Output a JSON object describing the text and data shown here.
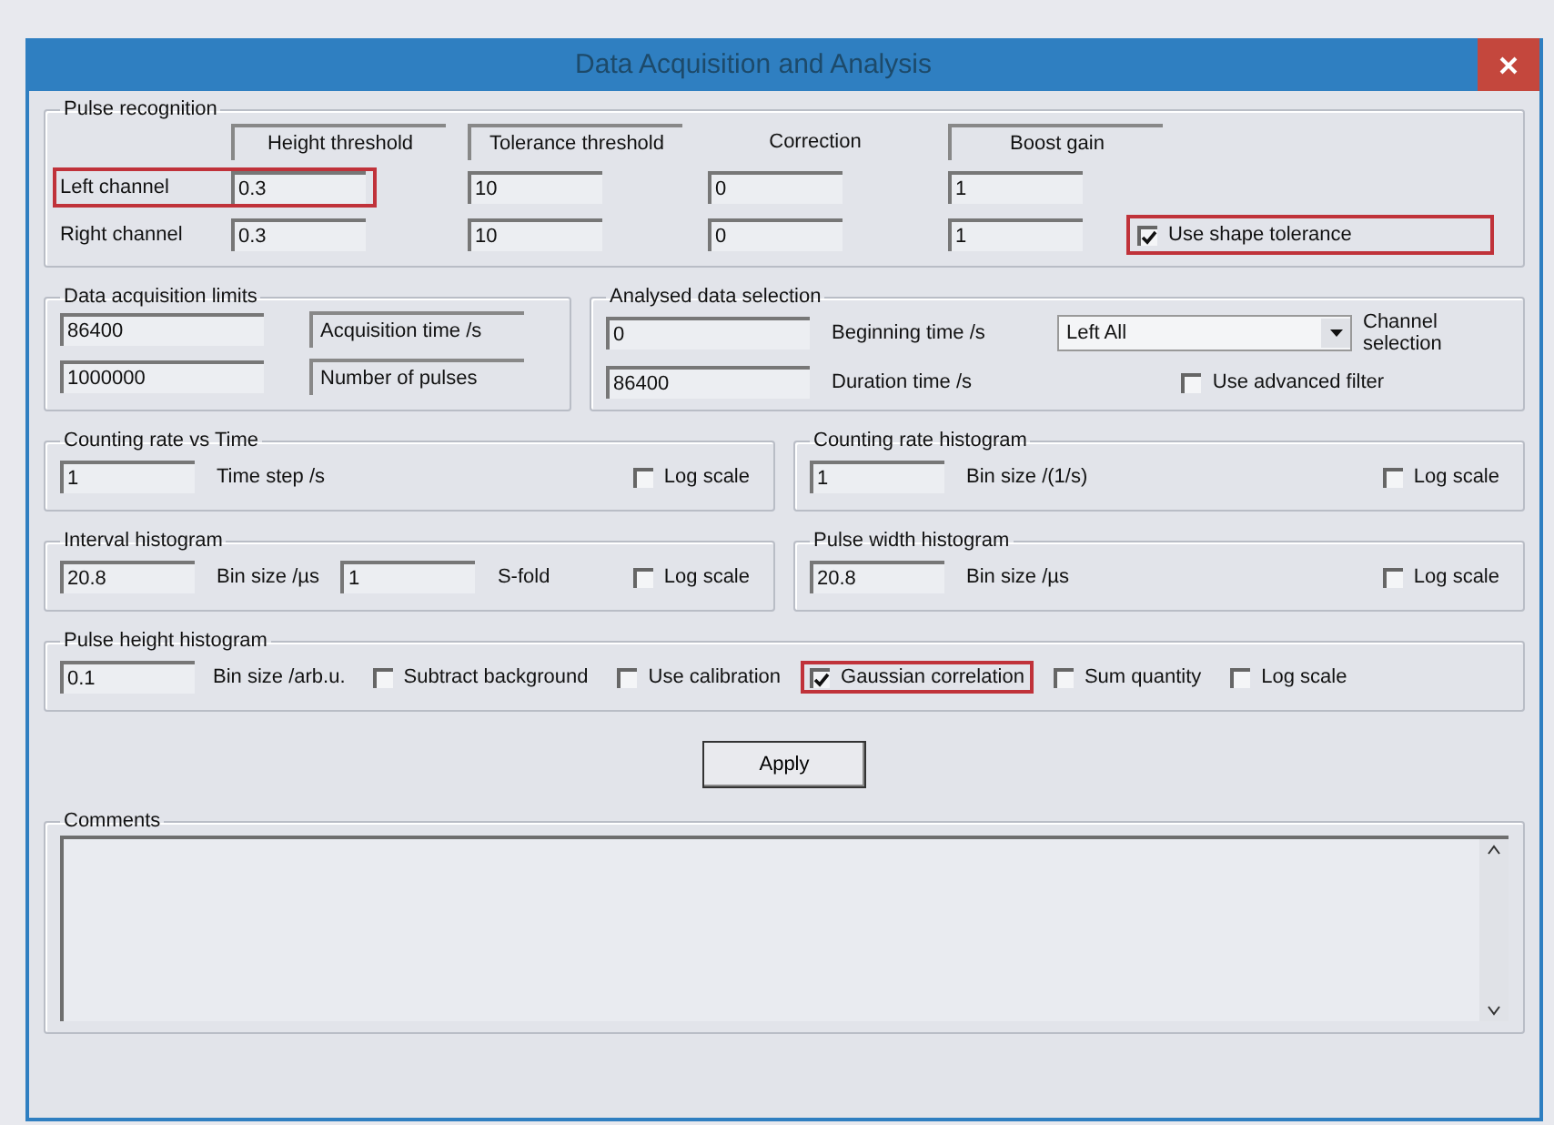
{
  "window": {
    "title": "Data Acquisition and Analysis"
  },
  "pulse_recognition": {
    "title": "Pulse recognition",
    "columns": [
      {
        "label": "Height threshold",
        "framed": true
      },
      {
        "label": "Tolerance threshold",
        "framed": true
      },
      {
        "label": "Correction",
        "framed": false
      },
      {
        "label": "Boost gain",
        "framed": true
      }
    ],
    "rows": [
      {
        "label": "Left channel",
        "values": [
          "0.3",
          "10",
          "0",
          "1"
        ],
        "highlighted": true
      },
      {
        "label": "Right channel",
        "values": [
          "0.3",
          "10",
          "0",
          "1"
        ],
        "highlighted": false
      }
    ],
    "shape_tolerance": {
      "label": "Use shape tolerance",
      "checked": true,
      "highlighted": true
    }
  },
  "data_acquisition_limits": {
    "title": "Data acquisition limits",
    "rows": [
      {
        "value": "86400",
        "label": "Acquisition time /s"
      },
      {
        "value": "1000000",
        "label": "Number of pulses"
      }
    ]
  },
  "analysed_data_selection": {
    "title": "Analysed data selection",
    "rows": [
      {
        "value": "0",
        "label": "Beginning time /s"
      },
      {
        "value": "86400",
        "label": "Duration time /s"
      }
    ],
    "channel_dropdown": {
      "value": "Left All",
      "label": "Channel selection"
    },
    "advanced_filter": {
      "label": "Use advanced filter",
      "checked": false
    }
  },
  "counting_rate_vs_time": {
    "title": "Counting rate vs Time",
    "value": "1",
    "unit": "Time step /s",
    "log_scale": {
      "label": "Log scale",
      "checked": false
    }
  },
  "counting_rate_histogram": {
    "title": "Counting rate histogram",
    "value": "1",
    "unit": "Bin size  /(1/s)",
    "log_scale": {
      "label": "Log scale",
      "checked": false
    }
  },
  "interval_histogram": {
    "title": "Interval histogram",
    "value": "20.8",
    "unit": "Bin size /µs",
    "s_fold": {
      "value": "1",
      "label": "S-fold"
    },
    "log_scale": {
      "label": "Log scale",
      "checked": false
    }
  },
  "pulse_width_histogram": {
    "title": "Pulse width histogram",
    "value": "20.8",
    "unit": "Bin size /µs",
    "log_scale": {
      "label": "Log scale",
      "checked": false
    }
  },
  "pulse_height_histogram": {
    "title": "Pulse height histogram",
    "value": "0.1",
    "unit": "Bin size /arb.u.",
    "options": [
      {
        "label": "Subtract background",
        "checked": false,
        "highlighted": false
      },
      {
        "label": "Use calibration",
        "checked": false,
        "highlighted": false
      },
      {
        "label": "Gaussian correlation",
        "checked": true,
        "highlighted": true
      },
      {
        "label": "Sum quantity",
        "checked": false,
        "highlighted": false
      },
      {
        "label": "Log scale",
        "checked": false,
        "highlighted": false
      }
    ]
  },
  "apply_button": "Apply",
  "comments": {
    "title": "Comments"
  }
}
